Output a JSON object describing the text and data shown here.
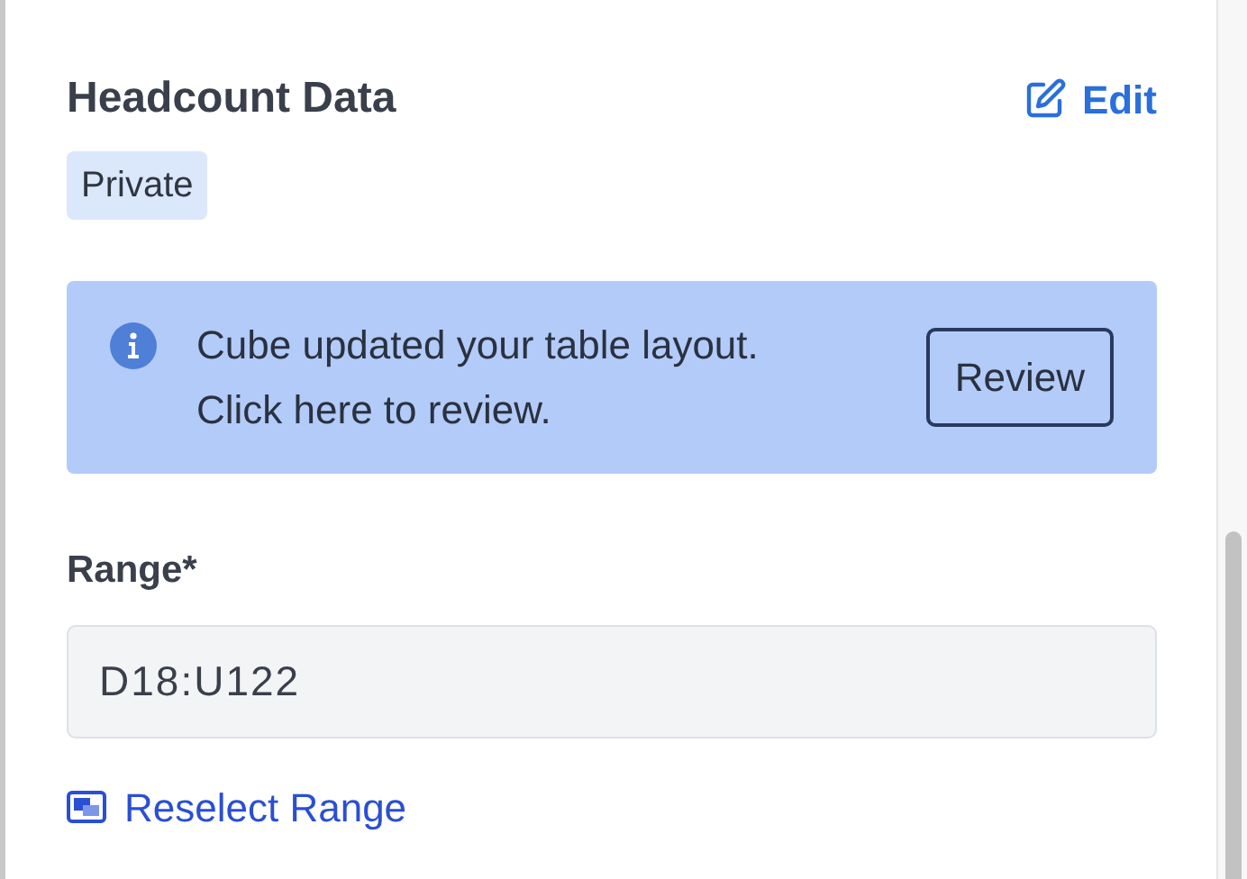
{
  "header": {
    "title": "Headcount Data",
    "edit_link": "Edit",
    "badge": "Private"
  },
  "notice": {
    "message": "Cube updated your table layout. Click here to review.",
    "button": "Review"
  },
  "range": {
    "label": "Range*",
    "value": "D18:U122",
    "reselect_link": "Reselect Range"
  }
}
